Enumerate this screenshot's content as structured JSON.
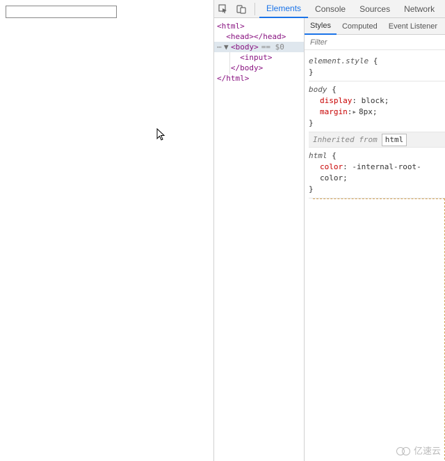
{
  "toolbar": {
    "tabs": [
      "Elements",
      "Console",
      "Sources",
      "Network"
    ],
    "active_tab": "Elements"
  },
  "styles_tabs": {
    "items": [
      "Styles",
      "Computed",
      "Event Listener"
    ],
    "active": "Styles"
  },
  "filter": {
    "placeholder": "Filter"
  },
  "dom": {
    "html_open": "<html>",
    "head": "<head></head>",
    "body_open": "<body>",
    "selected_suffix": "== $0",
    "input": "<input>",
    "body_close": "</body>",
    "html_close": "</html>"
  },
  "css": {
    "block1": {
      "selector": "element.style",
      "open": " {",
      "close": "}"
    },
    "block2": {
      "selector": "body",
      "open": " {",
      "prop1_name": "display",
      "prop1_val": "block",
      "prop2_name": "margin",
      "prop2_val": "8px",
      "close": "}"
    },
    "inherited_label": "Inherited from",
    "inherited_chip": "html",
    "block3": {
      "selector": "html",
      "open": " {",
      "prop1_name": "color",
      "prop1_val": "-internal-root-color",
      "close": "}"
    }
  },
  "watermark": {
    "text": "亿速云"
  },
  "separator": ":",
  "semicolon": ";",
  "tri_glyph": "▸"
}
